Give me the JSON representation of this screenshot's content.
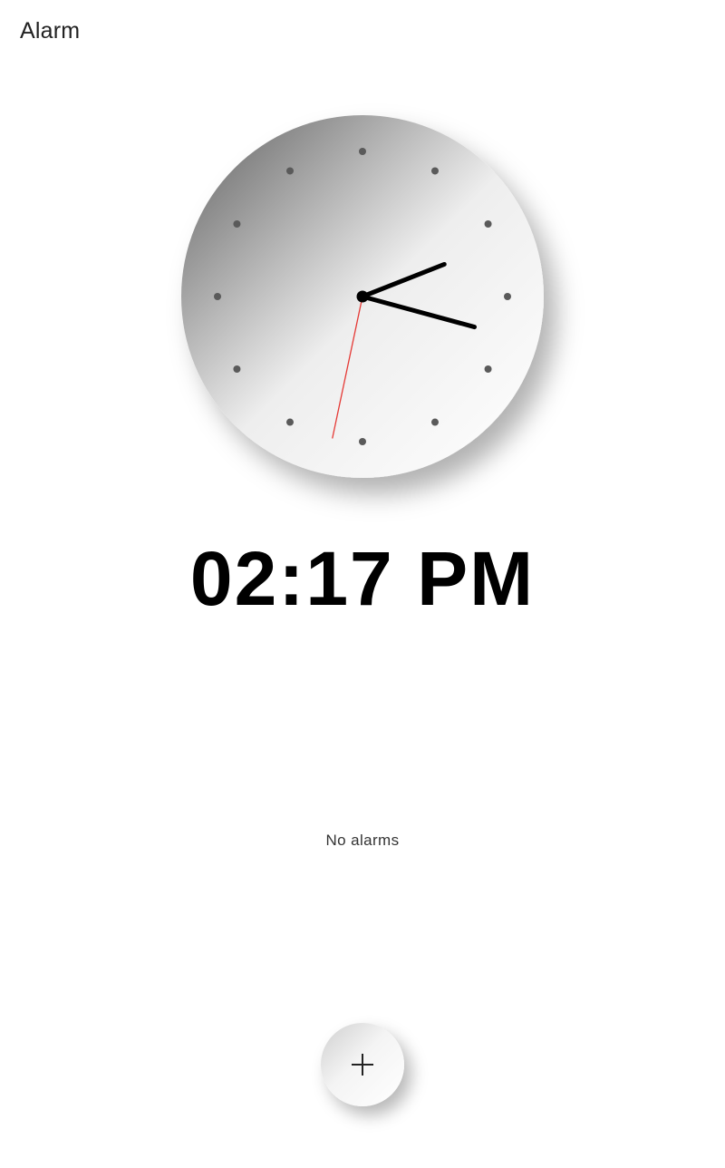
{
  "header": {
    "title": "Alarm"
  },
  "clock": {
    "hour": 2,
    "minute": 17,
    "second": 32,
    "hand_color": "#000000",
    "second_hand_color": "#e53935",
    "marker_color": "#5a5a5a",
    "face_gradient": [
      "#6f6f6f",
      "#f2f2f2",
      "#ffffff"
    ]
  },
  "digital": {
    "time_text": "02:17 PM"
  },
  "alarms": {
    "empty_text": "No alarms"
  },
  "fab": {
    "icon": "plus-icon"
  }
}
